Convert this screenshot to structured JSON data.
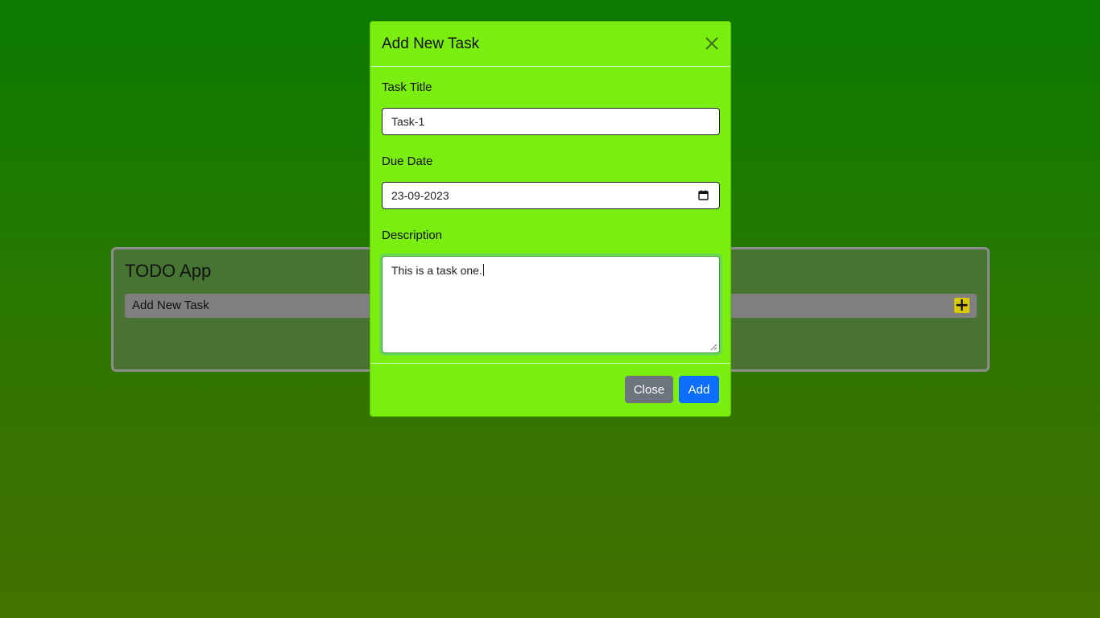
{
  "app": {
    "title": "TODO App",
    "add_row_label": "Add New Task",
    "add_icon": "plus-icon"
  },
  "modal": {
    "title": "Add New Task",
    "close_icon": "close-icon",
    "fields": {
      "title_label": "Task Title",
      "title_value": "Task-1",
      "due_label": "Due Date",
      "due_value": "23-09-2023",
      "description_label": "Description",
      "description_value": "This is a task one."
    },
    "footer": {
      "close_label": "Close",
      "add_label": "Add"
    }
  },
  "colors": {
    "modal_bg": "#7aee0f",
    "close_button": "#6c757d",
    "add_button": "#0d6efd",
    "plus_badge": "#d9c700"
  }
}
